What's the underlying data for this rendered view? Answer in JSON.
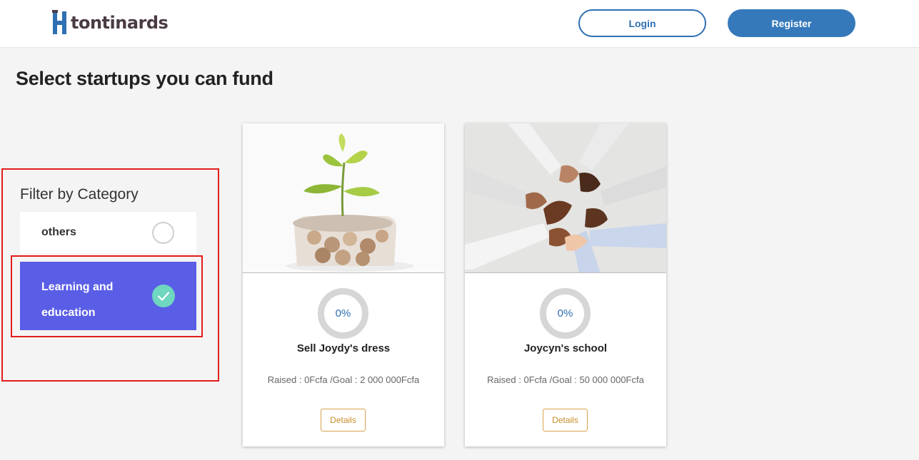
{
  "header": {
    "logo_text": "tontinards",
    "login_label": "Login",
    "register_label": "Register",
    "brand_color": "#3579bb"
  },
  "main": {
    "title": "Select startups you can fund"
  },
  "filter": {
    "title": "Filter by Category",
    "categories": [
      {
        "label": "others",
        "selected": false
      },
      {
        "label": "Learning and education",
        "selected": true
      }
    ],
    "selected_color": "#5a5ee6",
    "check_color": "#6fd6c0"
  },
  "cards": [
    {
      "title": "Sell Joydy's dress",
      "progress": "0%",
      "raised": "Raised : 0Fcfa /Goal : 2 000 000Fcfa",
      "details_label": "Details",
      "image": "plant-growing-from-coin-jar"
    },
    {
      "title": "Joycyn's school",
      "progress": "0%",
      "raised": "Raised : 0Fcfa /Goal : 50 000 000Fcfa",
      "details_label": "Details",
      "image": "linked-hands-circle"
    }
  ]
}
